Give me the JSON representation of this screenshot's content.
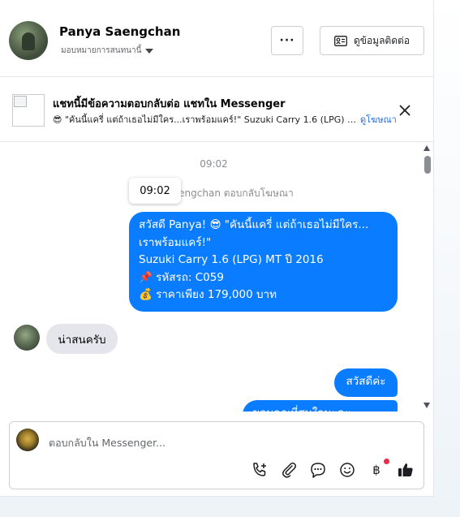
{
  "header": {
    "contact_name": "Panya Saengchan",
    "assignee_label": "มอบหมายการสนทนานี้",
    "more_label": "···",
    "view_contact_label": "ดูข้อมูลติดต่อ"
  },
  "banner": {
    "title": "แชทนี้มีข้อความตอบกลับต่อ แชทใน Messenger",
    "snippet": "😎 \"คันนี้แครี่ แต่ถ้าเธอไม่มีใคร...เราพร้อมแคร์!\" Suzuki Carry 1.6 (LPG) MT ปี 2016",
    "link_label": "ดูโฆษณา"
  },
  "chat": {
    "timestamp": "09:02",
    "system_note": "Panya Saengchan ตอบกลับโฆษณา",
    "tooltip_time": "09:02",
    "ad_message_lines": [
      "สวัสดี Panya! 😎 \"คันนี้แครี่ แต่ถ้าเธอไม่มีใคร...",
      "เราพร้อมแคร์!\"",
      "Suzuki Carry 1.6 (LPG) MT ปี 2016",
      "📌 รหัสรถ: C059",
      "💰 ราคาเพียง 179,000 บาท"
    ],
    "incoming_message": "น่าสนครับ",
    "outgoing_message": "สวัสดีค่ะ",
    "outgoing_partial": "ขอบคุณที่สนใจนะคะ"
  },
  "composer": {
    "placeholder": "ตอบกลับใน Messenger...",
    "tools": [
      "call-add-icon",
      "attachment-icon",
      "saved-replies-icon",
      "emoji-icon",
      "payment-baht-icon",
      "like-icon"
    ]
  },
  "colors": {
    "accent": "#0a7cff",
    "link": "#216fdb",
    "notification": "#f02849"
  }
}
